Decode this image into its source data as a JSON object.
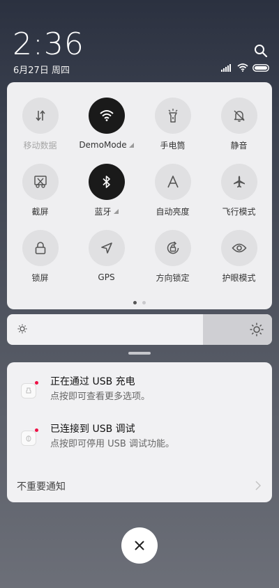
{
  "clock": {
    "time": "2:36",
    "date": "6月27日 周四"
  },
  "icons": {
    "search": "search-icon",
    "signal": "signal-icon",
    "wifi": "wifi-icon",
    "battery": "battery-icon"
  },
  "toggles": [
    {
      "label": "移动数据",
      "icon": "mobile-data-icon",
      "active": false,
      "dimmed": true
    },
    {
      "label": "DemoMode",
      "icon": "wifi-icon",
      "active": true,
      "expandable": true
    },
    {
      "label": "手电筒",
      "icon": "flashlight-icon",
      "active": false
    },
    {
      "label": "静音",
      "icon": "mute-icon",
      "active": false
    },
    {
      "label": "截屏",
      "icon": "screenshot-icon",
      "active": false
    },
    {
      "label": "蓝牙",
      "icon": "bluetooth-icon",
      "active": true,
      "expandable": true
    },
    {
      "label": "自动亮度",
      "icon": "auto-brightness-icon",
      "active": false
    },
    {
      "label": "飞行模式",
      "icon": "airplane-icon",
      "active": false
    },
    {
      "label": "锁屏",
      "icon": "lock-icon",
      "active": false
    },
    {
      "label": "GPS",
      "icon": "gps-icon",
      "active": false
    },
    {
      "label": "方向锁定",
      "icon": "rotation-lock-icon",
      "active": false
    },
    {
      "label": "护眼模式",
      "icon": "eye-icon",
      "active": false
    }
  ],
  "pager": {
    "pages": 2,
    "current": 1
  },
  "brightness": {
    "level_percent": 74
  },
  "notifications": {
    "items": [
      {
        "title": "正在通过 USB 充电",
        "subtitle": "点按即可查看更多选项。",
        "icon": "usb-charge-icon"
      },
      {
        "title": "已连接到 USB 调试",
        "subtitle": "点按即可停用 USB 调试功能。",
        "icon": "usb-debug-icon"
      }
    ],
    "unimportant_label": "不重要通知"
  },
  "colors": {
    "active_tile": "#1a1a1a",
    "inactive_tile": "#e0e0e2",
    "panel": "#efeff1"
  }
}
